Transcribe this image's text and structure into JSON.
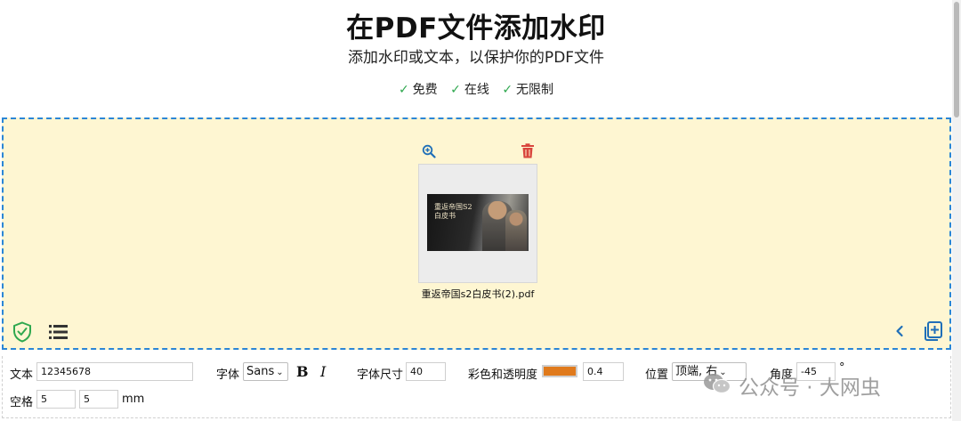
{
  "header": {
    "title": "在PDF文件添加水印",
    "subtitle": "添加水印或文本，以保护你的PDF文件",
    "features": [
      "免费",
      "在线",
      "无限制"
    ],
    "check_glyph": "✓"
  },
  "dropzone": {
    "file": {
      "name": "重返帝国s2白皮书(2).pdf",
      "thumb_text": "重返帝国S2\n白皮书"
    },
    "icons": [
      "zoom-in-icon",
      "trash-icon",
      "shield-check-icon",
      "list-icon",
      "chevron-left-icon",
      "add-file-icon"
    ],
    "colors": {
      "background": "#fef6d2",
      "border": "#2b86d6",
      "trash": "#d9453d",
      "shield": "#2fa84f",
      "accent": "#2b86d6"
    }
  },
  "settings": {
    "text_label": "文本",
    "text_value": "12345678",
    "font_label": "字体",
    "font_value": "Sans",
    "bold_label": "B",
    "italic_label": "I",
    "size_label": "字体尺寸",
    "size_value": "40",
    "color_label": "彩色和透明度",
    "color_value": "#e07a1c",
    "opacity_value": "0.4",
    "position_label": "位置",
    "position_value": "顶端, 右",
    "angle_label": "角度",
    "angle_value": "-45",
    "angle_unit": "°",
    "spacing_label": "空格",
    "spacing_x": "5",
    "spacing_y": "5",
    "spacing_unit": "mm"
  },
  "watermark": {
    "text": "公众号 · 大网虫"
  }
}
